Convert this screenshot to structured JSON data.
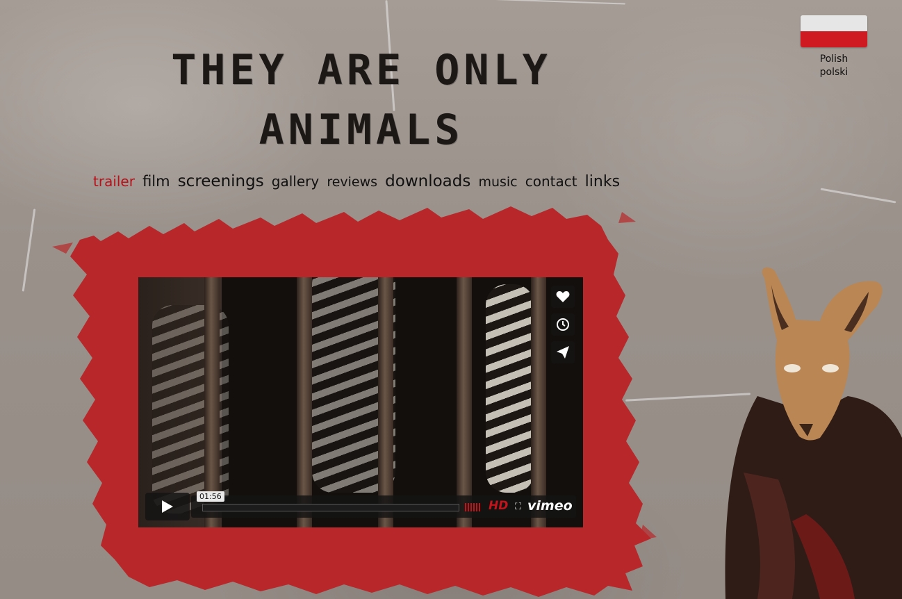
{
  "site": {
    "title_line1": "THEY ARE ONLY",
    "title_line2": "ANIMALS"
  },
  "language": {
    "label_en": "Polish",
    "label_native": "polski",
    "flag_colors": [
      "#e6e6e6",
      "#d01a22"
    ]
  },
  "nav": {
    "items": [
      {
        "label": "trailer",
        "active": true
      },
      {
        "label": "film"
      },
      {
        "label": "screenings"
      },
      {
        "label": "gallery"
      },
      {
        "label": "reviews"
      },
      {
        "label": "downloads"
      },
      {
        "label": "music"
      },
      {
        "label": "contact"
      },
      {
        "label": "links"
      }
    ]
  },
  "video": {
    "duration": "01:56",
    "hd_label": "HD",
    "brand": "vimeo",
    "side_buttons": [
      "heart-icon",
      "clock-icon",
      "send-icon"
    ],
    "accent_color": "#c3131b"
  },
  "colors": {
    "splat": "#b8282b",
    "active_link": "#b5121b"
  }
}
